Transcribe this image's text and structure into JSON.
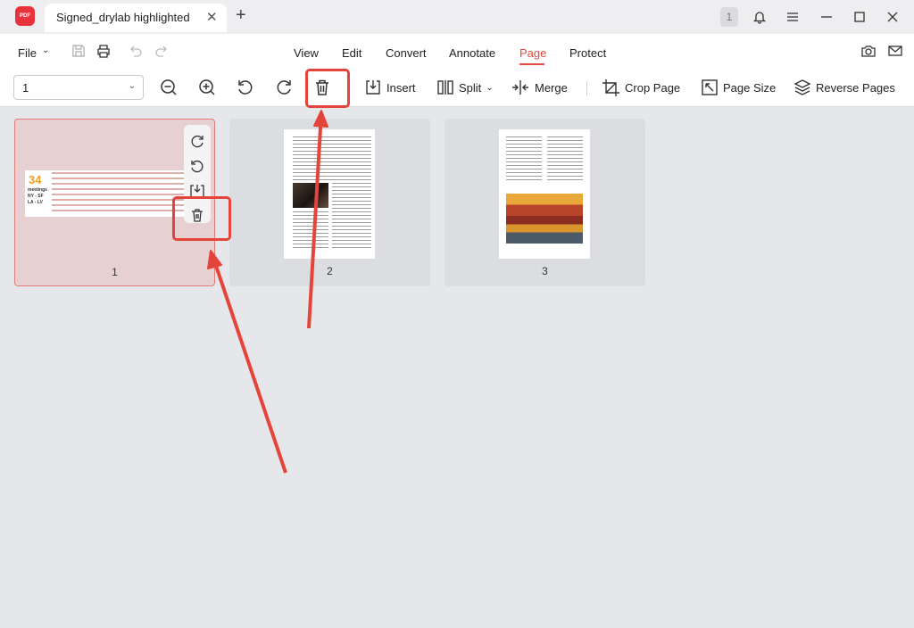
{
  "app": {
    "logo_text": "PDF"
  },
  "tab": {
    "title": "Signed_drylab highlighted",
    "close_icon": "close-icon",
    "new_tab_icon": "plus-icon"
  },
  "titlebar": {
    "notification_count": "1"
  },
  "menubar": {
    "file_label": "File",
    "items": [
      {
        "label": "View",
        "active": false
      },
      {
        "label": "Edit",
        "active": false
      },
      {
        "label": "Convert",
        "active": false
      },
      {
        "label": "Annotate",
        "active": false
      },
      {
        "label": "Page",
        "active": true
      },
      {
        "label": "Protect",
        "active": false
      }
    ]
  },
  "toolbar": {
    "page_select_value": "1",
    "insert_label": "Insert",
    "split_label": "Split",
    "merge_label": "Merge",
    "crop_label": "Crop Page",
    "page_size_label": "Page Size",
    "reverse_label": "Reverse Pages"
  },
  "pages": [
    {
      "number": "1",
      "selected": true,
      "thumb_number": "34",
      "thumb_words": [
        "meetings",
        "NY - SF",
        "LA - LV"
      ]
    },
    {
      "number": "2",
      "selected": false
    },
    {
      "number": "3",
      "selected": false
    }
  ],
  "colors": {
    "accent": "#e5483f",
    "annotation": "#e5443b",
    "selected_card": "#e6d0d2"
  }
}
